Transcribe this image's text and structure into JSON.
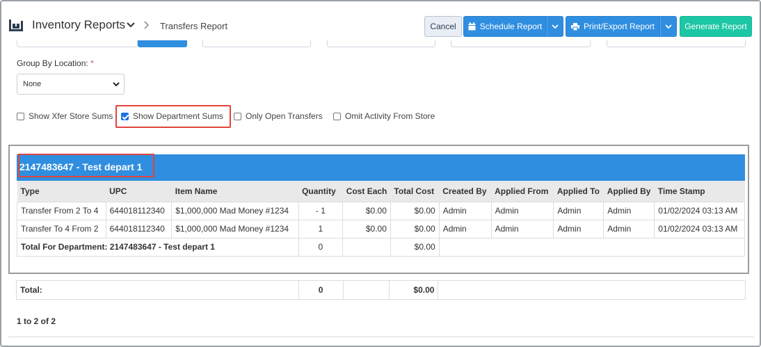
{
  "header": {
    "title": "Inventory Reports",
    "breadcrumb": "Transfers Report"
  },
  "toolbar": {
    "cancel_label": "Cancel",
    "schedule_label": "Schedule Report",
    "print_label": "Print/Export Report",
    "generate_label": "Generate Report"
  },
  "filters": {
    "group_by_label": "Group By Location:",
    "required_mark": "*",
    "group_by_value": "None",
    "checkboxes": [
      {
        "label": "Show Xfer Store Sums",
        "checked": false
      },
      {
        "label": "Show Department Sums",
        "checked": true
      },
      {
        "label": "Only Open Transfers",
        "checked": false
      },
      {
        "label": "Omit Activity From Store",
        "checked": false
      }
    ]
  },
  "report": {
    "department_title": "2147483647 - Test depart 1",
    "columns": [
      "Type",
      "UPC",
      "Item Name",
      "Quantity",
      "Cost Each",
      "Total Cost",
      "Created By",
      "Applied From",
      "Applied To",
      "Applied By",
      "Time Stamp"
    ],
    "rows": [
      [
        "Transfer From 2 To 4",
        "644018112340",
        "$1,000,000 Mad Money #1234",
        "- 1",
        "$0.00",
        "$0.00",
        "Admin",
        "Admin",
        "Admin",
        "Admin",
        "01/02/2024 03:13 AM"
      ],
      [
        "Transfer To 4 From 2",
        "644018112340",
        "$1,000,000 Mad Money #1234",
        "1",
        "$0.00",
        "$0.00",
        "Admin",
        "Admin",
        "Admin",
        "Admin",
        "01/02/2024 03:13 AM"
      ]
    ],
    "dept_total": {
      "label": "Total For Department: 2147483647 - Test depart 1",
      "quantity": "0",
      "total_cost": "$0.00"
    }
  },
  "grand_total": {
    "label": "Total:",
    "quantity": "0",
    "total_cost": "$0.00"
  },
  "pager": "1 to 2 of 2",
  "colors": {
    "accent_blue": "#2f8ee0",
    "generate_green": "#1cc7a5",
    "highlight_red": "#e0443e"
  }
}
